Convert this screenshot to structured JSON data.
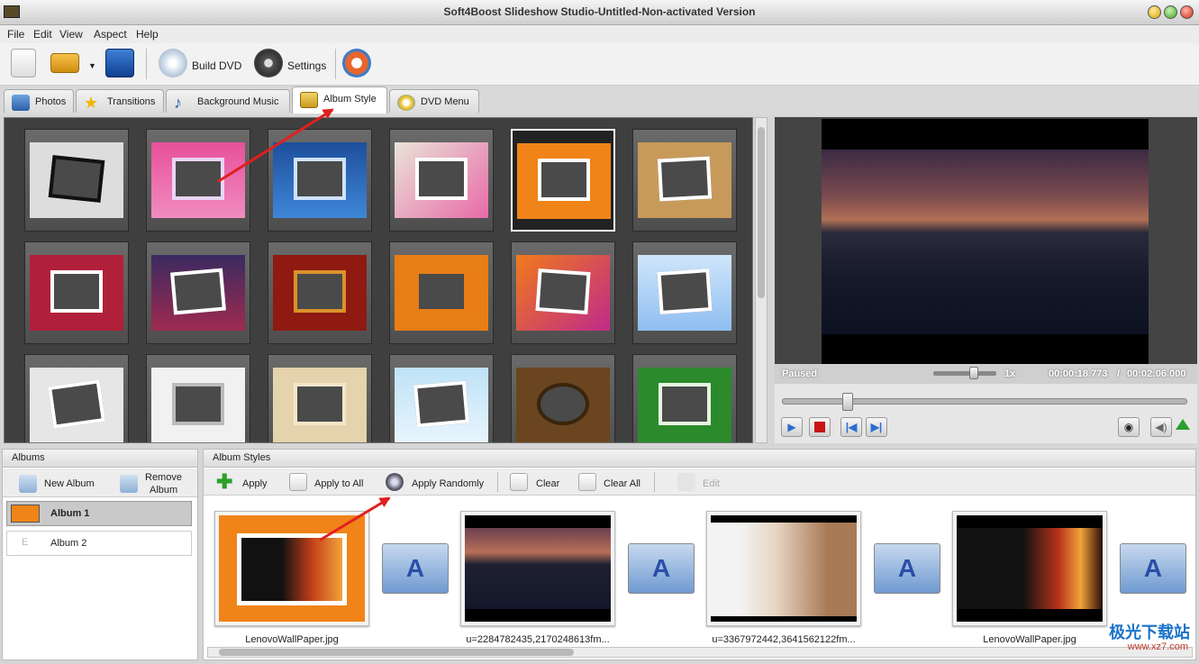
{
  "window": {
    "title": "Soft4Boost Slideshow Studio-Untitled-Non-activated Version"
  },
  "menu": [
    "File",
    "Edit",
    "View",
    "Aspect",
    "Help"
  ],
  "toolbar": {
    "build_dvd": "Build DVD",
    "settings": "Settings"
  },
  "tabs": [
    {
      "label": "Photos"
    },
    {
      "label": "Transitions"
    },
    {
      "label": "Background Music"
    },
    {
      "label": "Album Style"
    },
    {
      "label": "DVD Menu"
    }
  ],
  "preview": {
    "status": "Paused",
    "speed": "1x",
    "current_time": "00:00:18.773",
    "separator": "/",
    "total_time": "00:02:06.000"
  },
  "albums": {
    "header": "Albums",
    "new_album": "New Album",
    "remove_album_line1": "Remove",
    "remove_album_line2": "Album",
    "items": [
      {
        "label": "Album 1"
      },
      {
        "label": "Album 2"
      }
    ]
  },
  "album_styles": {
    "header": "Album Styles",
    "apply": "Apply",
    "apply_all": "Apply to All",
    "apply_random": "Apply Randomly",
    "clear": "Clear",
    "clear_all": "Clear All",
    "edit": "Edit"
  },
  "slides": [
    {
      "name": "LenovoWallPaper.jpg"
    },
    {
      "name": "u=2284782435,2170248613fm..."
    },
    {
      "name": "u=3367972442,3641562122fm..."
    },
    {
      "name": "LenovoWallPaper.jpg"
    }
  ],
  "transition_glyph": "A",
  "watermark": {
    "text": "极光下载站",
    "url": "www.xz7.com"
  }
}
